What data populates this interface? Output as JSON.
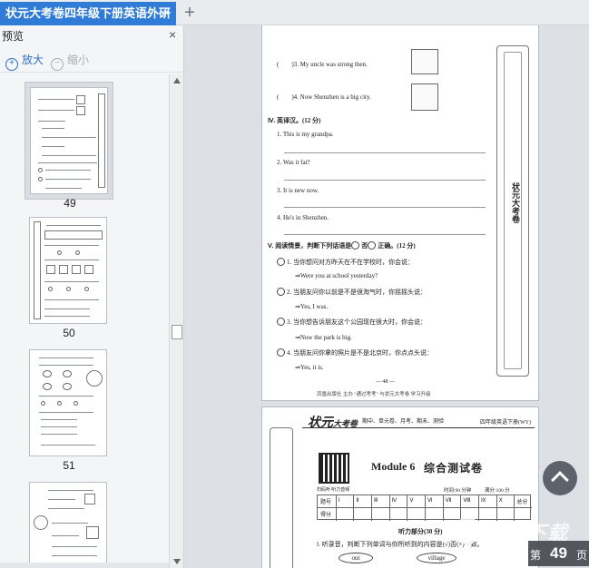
{
  "tab": {
    "title": "状元大考卷四年级下册英语外研",
    "close": "×",
    "new_tab": "+"
  },
  "sidebar": {
    "title": "预览",
    "close": "×",
    "zoom_in": "放大",
    "zoom_out": "缩小",
    "thumbnails": [
      {
        "label": "49",
        "selected": true
      },
      {
        "label": "50",
        "selected": false
      },
      {
        "label": "51",
        "selected": false
      },
      {
        "label": "",
        "selected": false
      }
    ]
  },
  "page48": {
    "q3": "(　　)3. My uncle was strong then.",
    "q4": "(　　)4. Now Shenzhen is a big city.",
    "sec4_title": "Ⅳ. 英译汉。(12 分)",
    "s1": "1. This is my grandpa.",
    "s2": "2. Was it fat?",
    "s3": "3. It is new now.",
    "s4": "4. He's in Shenzhen.",
    "sec5_title_a": "Ⅴ. 阅读情景，判断下列话语是",
    "sec5_yes": "否",
    "sec5_title_b": "正确。(12 分)",
    "c1": "1. 当你想问对方昨天在不在学校时，你会说：",
    "c1a": "⇒Were you at school yesterday?",
    "c2": "2. 当朋友问你以前是不是很淘气时，你摇摇头说：",
    "c2a": "⇒Yes, I was.",
    "c3": "3. 当你想告诉朋友这个公园现在很大时，你会说：",
    "c3a": "⇒Now the park is big.",
    "c4": "4. 当朋友问你拿的照片是不是北京时，你点点头说：",
    "c4a": "⇒Yes, it is.",
    "page_no": "— 48 —",
    "footer": "凤凰出版社 主办 \"通过考考\" 与状元大考卷 学习升级",
    "side_logo": "状元大考卷"
  },
  "page49": {
    "logo": "状元",
    "logo2": "大考卷",
    "sub": "期中、单元卷、月考、期末、测验",
    "grade": "四年级英语下册(WY)",
    "module": "Module 6",
    "title": "综合测试卷",
    "time": "时间:90 分钟",
    "total": "满分:100 分",
    "table_row1": [
      "题号",
      "Ⅰ",
      "Ⅱ",
      "Ⅲ",
      "Ⅳ",
      "Ⅴ",
      "Ⅵ",
      "Ⅶ",
      "Ⅷ",
      "Ⅸ",
      "Ⅹ",
      "总分"
    ],
    "table_row2": [
      "得分"
    ],
    "listening": "听力部分(30 分)",
    "q1": "Ⅰ. 听录音，判断下列单词与你所听到的内容是(√)否(×)一致。",
    "word1": "out",
    "word2": "village",
    "scan": "扫码听 听力音频",
    "stamp": "状元"
  },
  "overlay": {
    "page_prefix": "第",
    "page_number": "49",
    "page_suffix": "页",
    "watermark": "极光下载"
  }
}
